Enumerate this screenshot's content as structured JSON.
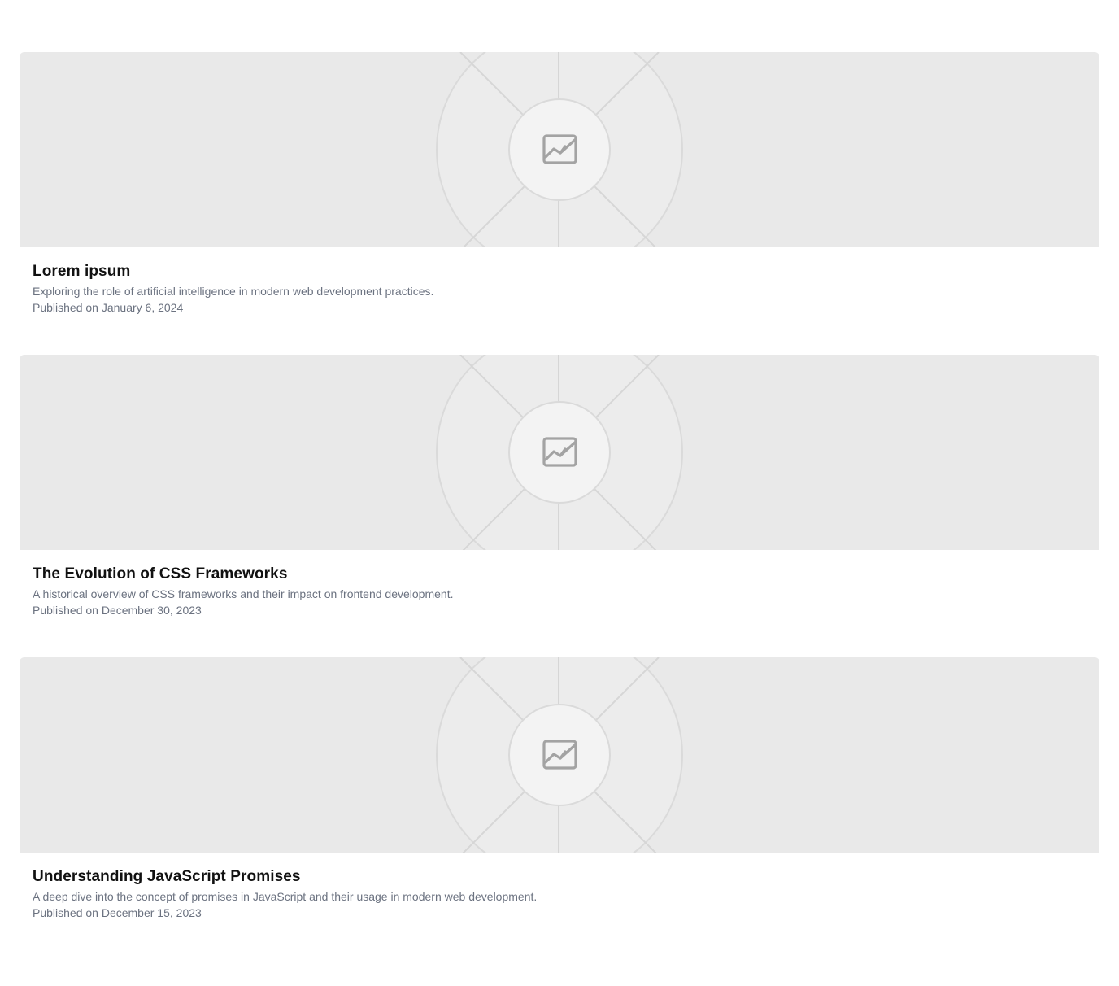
{
  "posts": [
    {
      "title": "Lorem ipsum",
      "description": "Exploring the role of artificial intelligence in modern web development practices.",
      "date": "Published on January 6, 2024",
      "image_icon": "image-placeholder-icon"
    },
    {
      "title": "The Evolution of CSS Frameworks",
      "description": "A historical overview of CSS frameworks and their impact on frontend development.",
      "date": "Published on December 30, 2023",
      "image_icon": "image-placeholder-icon"
    },
    {
      "title": "Understanding JavaScript Promises",
      "description": "A deep dive into the concept of promises in JavaScript and their usage in modern web development.",
      "date": "Published on December 15, 2023",
      "image_icon": "image-placeholder-icon"
    }
  ],
  "colors": {
    "placeholder_bg": "#e9e9e9",
    "title": "#111111",
    "muted_text": "#6b7280",
    "icon": "#a3a3a3"
  }
}
